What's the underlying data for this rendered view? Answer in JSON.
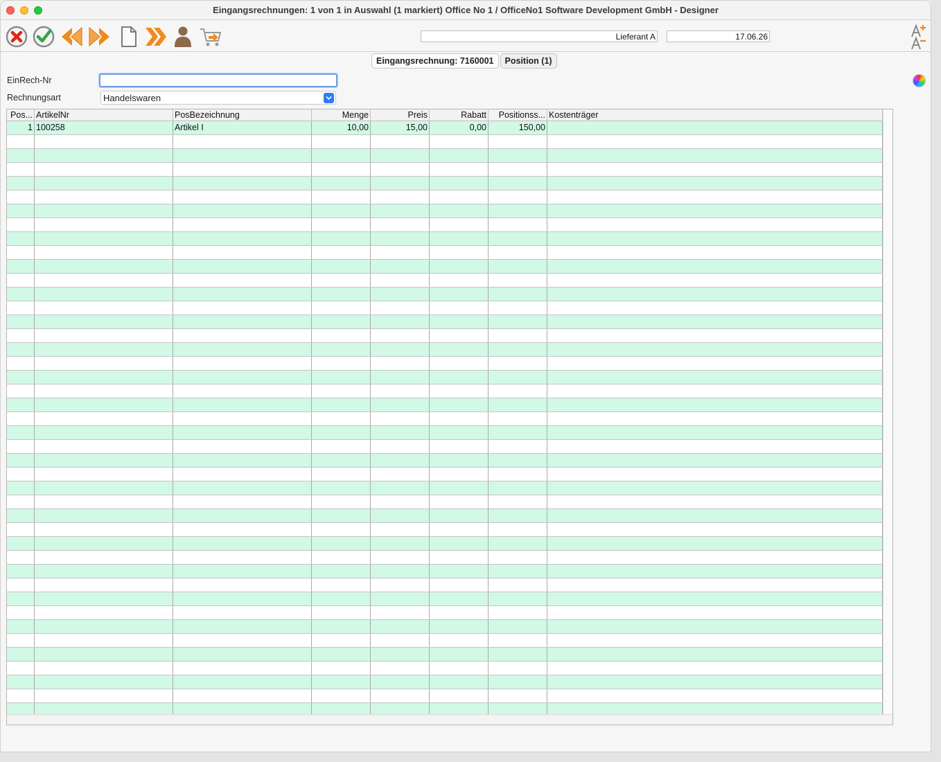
{
  "window": {
    "title": "Eingangsrechnungen: 1 von 1 in Auswahl  (1 markiert) Office No 1 /  OfficeNo1 Software Development GmbH - Designer"
  },
  "toolbar": {
    "icons": [
      "cancel-icon",
      "confirm-icon",
      "previous-icon",
      "next-icon",
      "new-document-icon",
      "fast-forward-icon",
      "person-icon",
      "cart-icon",
      "font-size-icon"
    ],
    "supplier_field": "Lieferant A",
    "date_field": "17.06.26"
  },
  "tabs": [
    {
      "label": "Eingangsrechnung: 7160001"
    },
    {
      "label": "Position (1)"
    }
  ],
  "form": {
    "einrech_label": "EinRech-Nr",
    "einrech_value": "",
    "rechnungsart_label": "Rechnungsart",
    "rechnungsart_value": "Handelswaren"
  },
  "table": {
    "columns": [
      {
        "label": "Pos..."
      },
      {
        "label": "ArtikelNr"
      },
      {
        "label": "PosBezeichnung"
      },
      {
        "label": "Menge"
      },
      {
        "label": "Preis"
      },
      {
        "label": "Rabatt"
      },
      {
        "label": "Positionss..."
      },
      {
        "label": "Kostenträger"
      }
    ],
    "rows": [
      [
        "1",
        "100258",
        "Artikel I",
        "10,00",
        "15,00",
        "0,00",
        "150,00",
        ""
      ]
    ],
    "empty_rows": 42
  },
  "colors": {
    "row_alt": "#d2f8e6",
    "accent": "#2f7cf6",
    "icon_orange": "#f08a1c",
    "icon_red": "#e0251c",
    "icon_green": "#3aa24a"
  }
}
